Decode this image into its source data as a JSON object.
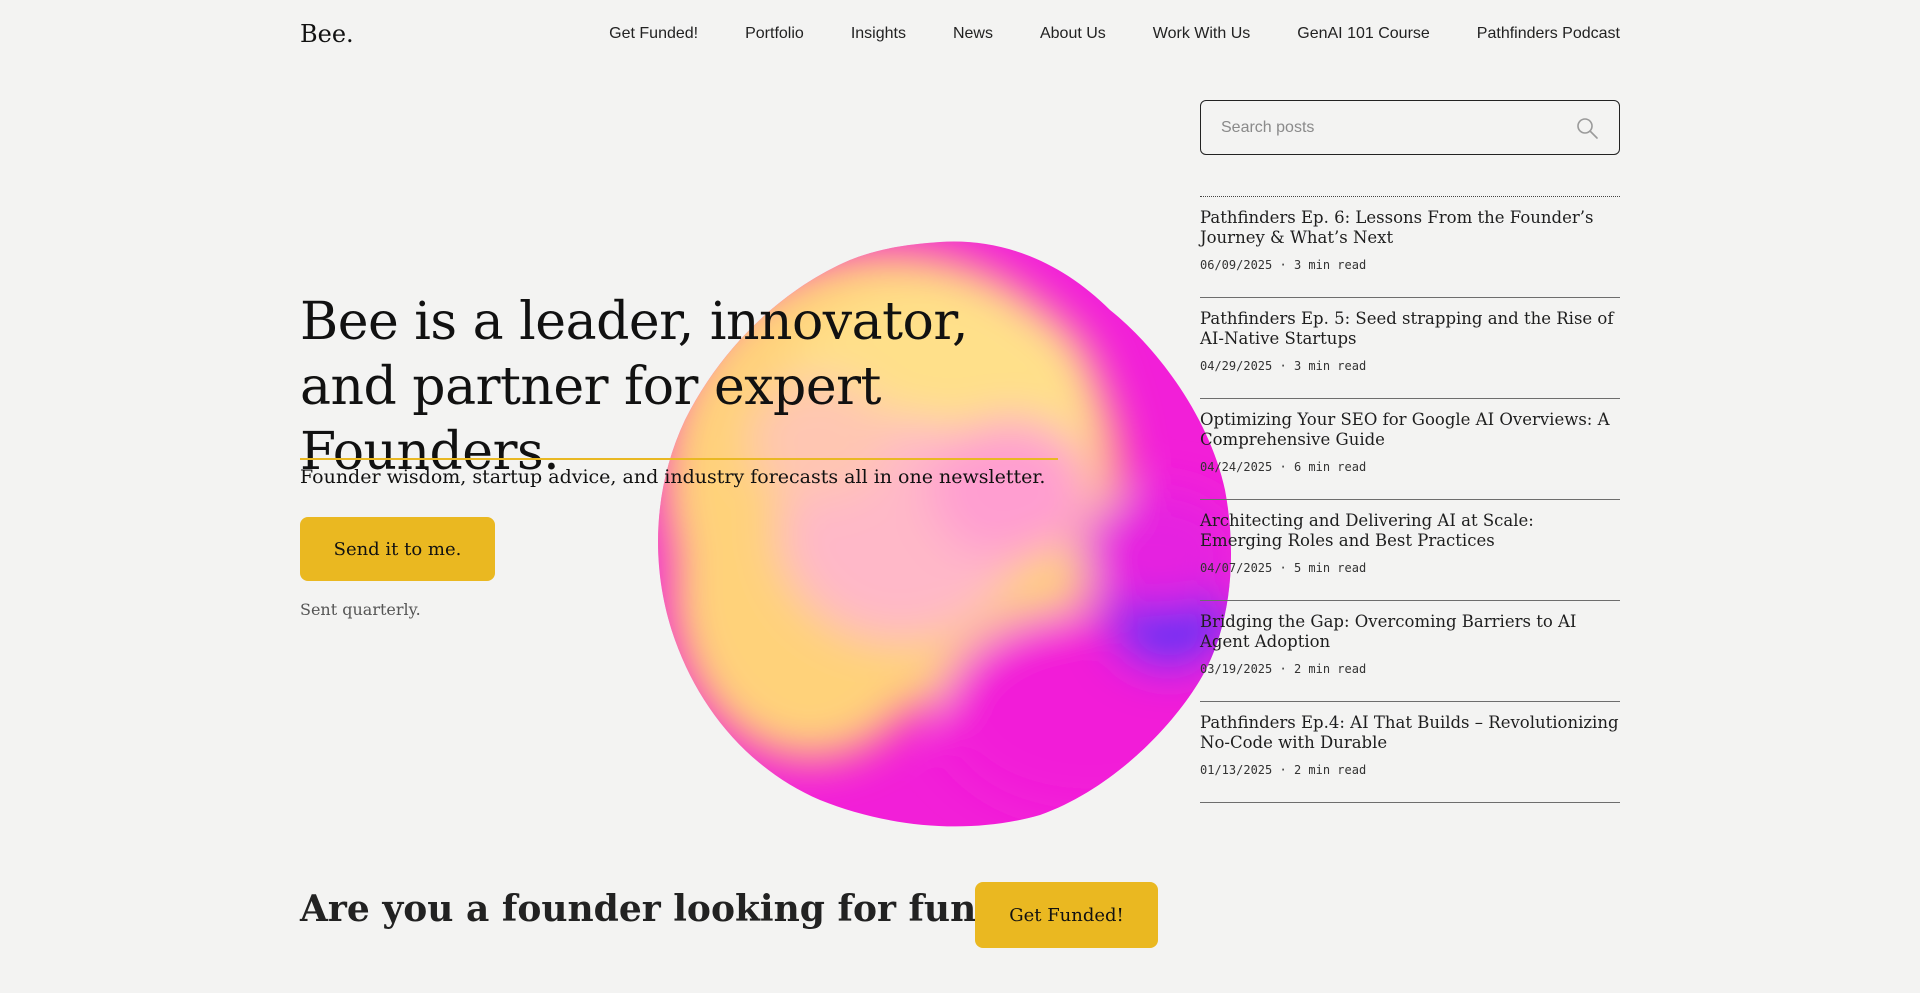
{
  "header": {
    "logo": "Bee.",
    "nav": [
      "Get Funded!",
      "Portfolio",
      "Insights",
      "News",
      "About Us",
      "Work With Us",
      "GenAI 101 Course",
      "Pathfinders Podcast"
    ]
  },
  "hero": {
    "title": "Bee is a leader, innovator, and partner for expert Founders.",
    "subtitle": "Founder wisdom, startup advice, and industry forecasts all in one newsletter.",
    "button_label": "Send it to me.",
    "note": "Sent quarterly."
  },
  "cta": {
    "question": "Are you a founder looking for funding?",
    "button_label": "Get Funded!"
  },
  "search": {
    "placeholder": "Search posts",
    "icon": "search-icon"
  },
  "posts": [
    {
      "title": "Pathfinders Ep. 6: Lessons From the Founder’s Journey & What’s Next",
      "date": "06/09/2025",
      "read": "3 min read"
    },
    {
      "title": "Pathfinders Ep. 5: Seed strapping and the Rise of AI-Native Startups",
      "date": "04/29/2025",
      "read": "3 min read"
    },
    {
      "title": "Optimizing Your SEO for Google AI Overviews: A Comprehensive Guide",
      "date": "04/24/2025",
      "read": "6 min read"
    },
    {
      "title": "Architecting and Delivering AI at Scale: Emerging Roles and Best Practices",
      "date": "04/07/2025",
      "read": "5 min read"
    },
    {
      "title": "Bridging the Gap: Overcoming Barriers to AI Agent Adoption",
      "date": "03/19/2025",
      "read": "2 min read"
    },
    {
      "title": "Pathfinders Ep.4: AI That Builds – Revolutionizing No-Code with Durable",
      "date": "01/13/2025",
      "read": "2 min read"
    }
  ],
  "colors": {
    "background": "#f3f3f2",
    "accent": "#eab821",
    "blob_pink": "#f21fd8",
    "blob_yellow": "#ffd27a",
    "blob_blue": "#5a33f5"
  }
}
